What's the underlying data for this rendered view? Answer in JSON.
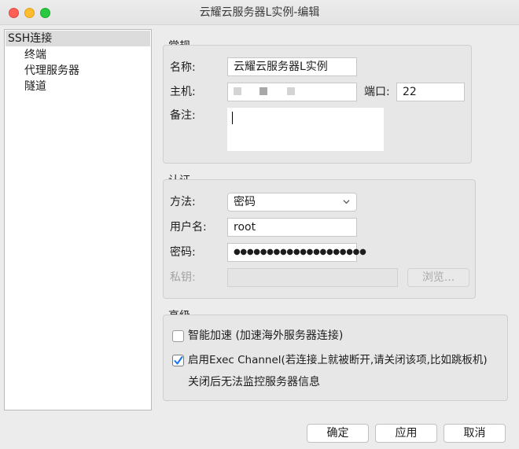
{
  "window": {
    "title": "云耀云服务器L实例-编辑"
  },
  "sidebar": {
    "root": "SSH连接",
    "children": [
      "终端",
      "代理服务器",
      "隧道"
    ]
  },
  "general": {
    "group_title": "常规",
    "name_label": "名称:",
    "name_value": "云耀云服务器L实例",
    "host_label": "主机:",
    "port_label": "端口:",
    "port_value": "22",
    "note_label": "备注:"
  },
  "auth": {
    "group_title": "认证",
    "method_label": "方法:",
    "method_value": "密码",
    "username_label": "用户名:",
    "username_value": "root",
    "password_label": "密码:",
    "password_value": "●●●●●●●●●●●●●●●●●●●●",
    "private_key_label": "私钥:",
    "browse_label": "浏览..."
  },
  "advanced": {
    "group_title": "高级",
    "smart_accel_label": "智能加速 (加速海外服务器连接)",
    "smart_accel_checked": false,
    "exec_channel_label": "启用Exec Channel(若连接上就被断开,请关闭该项,比如跳板机)",
    "exec_channel_checked": true,
    "exec_channel_note": "关闭后无法监控服务器信息"
  },
  "footer": {
    "ok_label": "确定",
    "apply_label": "应用",
    "cancel_label": "取消"
  },
  "colors": {
    "checkbox_accent": "#1a73e8"
  }
}
